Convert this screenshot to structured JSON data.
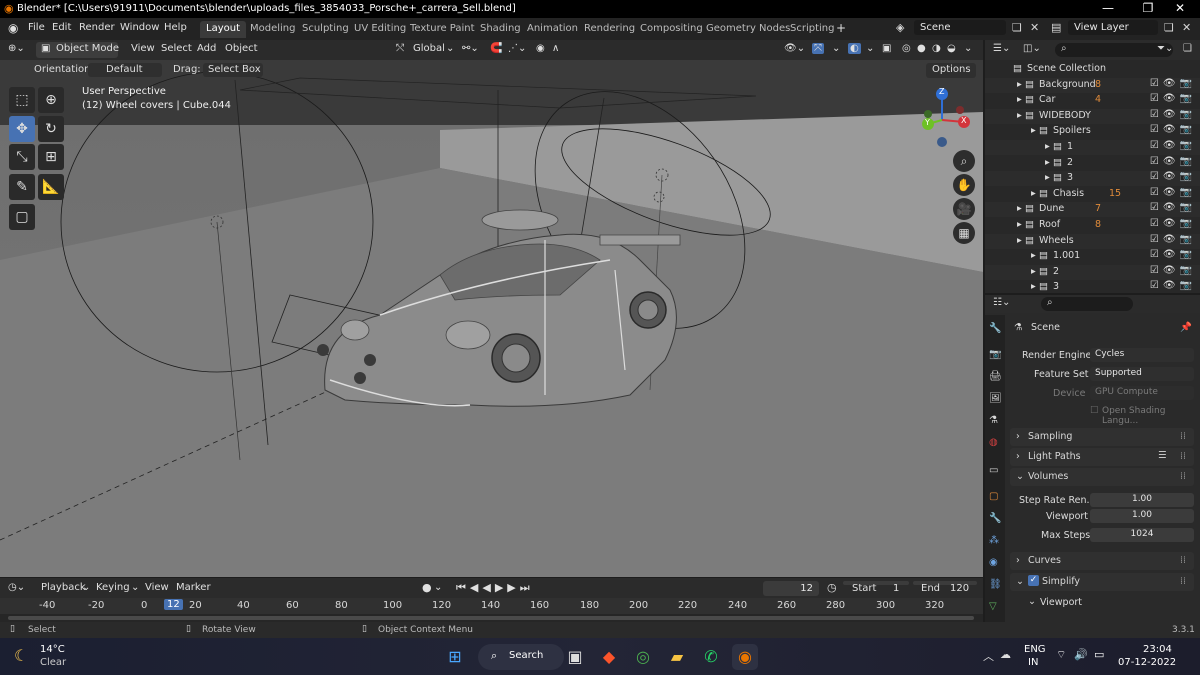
{
  "window": {
    "title": "Blender* [C:\\Users\\91911\\Documents\\blender\\uploads_files_3854033_Porsche+_carrera_Sell.blend]"
  },
  "menus": [
    "File",
    "Edit",
    "Render",
    "Window",
    "Help"
  ],
  "workspaces": [
    "Layout",
    "Modeling",
    "Sculpting",
    "UV Editing",
    "Texture Paint",
    "Shading",
    "Animation",
    "Rendering",
    "Compositing",
    "Geometry Nodes",
    "Scripting"
  ],
  "scene_field": "Scene",
  "view_layer_field": "View Layer",
  "viewport_header": {
    "mode": "Object Mode",
    "menu": [
      "View",
      "Select",
      "Add",
      "Object"
    ],
    "transform": "Global",
    "options": "Options",
    "orientation_label": "Orientation:",
    "orientation_value": "Default",
    "drag_label": "Drag:",
    "drag_value": "Select Box"
  },
  "viewport": {
    "perspective": "User Perspective",
    "selection": "(12) Wheel covers | Cube.044",
    "axis_x": "X",
    "axis_y": "Y",
    "axis_z": "Z"
  },
  "timeline": {
    "menus": [
      "Playback",
      "Keying",
      "View",
      "Marker"
    ],
    "current_frame": "12",
    "start_label": "Start",
    "start": "1",
    "end_label": "End",
    "end": "120",
    "ruler": [
      "-40",
      "-20",
      "0",
      "12",
      "20",
      "40",
      "60",
      "80",
      "100",
      "120",
      "140",
      "160",
      "180",
      "200",
      "220",
      "240",
      "260",
      "280",
      "300",
      "320"
    ]
  },
  "statusbar": {
    "left": "Select",
    "mid": "Rotate View",
    "right": "Object Context Menu",
    "version": "3.3.1"
  },
  "outliner": {
    "rows": [
      {
        "label": "Scene Collection",
        "indent": 0,
        "badge": ""
      },
      {
        "label": "Background",
        "indent": 1,
        "badge": "8"
      },
      {
        "label": "Car",
        "indent": 1,
        "badge": "4"
      },
      {
        "label": "WIDEBODY",
        "indent": 1,
        "badge": ""
      },
      {
        "label": "Spoilers",
        "indent": 2,
        "badge": ""
      },
      {
        "label": "1",
        "indent": 3,
        "badge": ""
      },
      {
        "label": "2",
        "indent": 3,
        "badge": ""
      },
      {
        "label": "3",
        "indent": 3,
        "badge": ""
      },
      {
        "label": "Chasis",
        "indent": 2,
        "badge": "15"
      },
      {
        "label": "Dune",
        "indent": 1,
        "badge": "7"
      },
      {
        "label": "Roof",
        "indent": 1,
        "badge": "8"
      },
      {
        "label": "Wheels",
        "indent": 1,
        "badge": ""
      },
      {
        "label": "1.001",
        "indent": 2,
        "badge": ""
      },
      {
        "label": "2",
        "indent": 2,
        "badge": ""
      },
      {
        "label": "3",
        "indent": 2,
        "badge": ""
      }
    ]
  },
  "properties": {
    "context": "Scene",
    "render_engine_label": "Render Engine",
    "render_engine": "Cycles",
    "feature_set_label": "Feature Set",
    "feature_set": "Supported",
    "device_label": "Device",
    "device": "GPU Compute",
    "osl": "Open Shading Langu...",
    "sampling": "Sampling",
    "light_paths": "Light Paths",
    "volumes": "Volumes",
    "step_rate_label": "Step Rate Ren...",
    "step_rate": "1.00",
    "viewport_label": "Viewport",
    "viewport_val": "1.00",
    "max_steps_label": "Max Steps",
    "max_steps": "1024",
    "curves": "Curves",
    "simplify": "Simplify",
    "simplify_viewport": "Viewport"
  },
  "taskbar": {
    "weather_temp": "14°C",
    "weather_cond": "Clear",
    "search": "Search",
    "lang1": "ENG",
    "lang2": "IN",
    "time": "23:04",
    "date": "07-12-2022"
  }
}
